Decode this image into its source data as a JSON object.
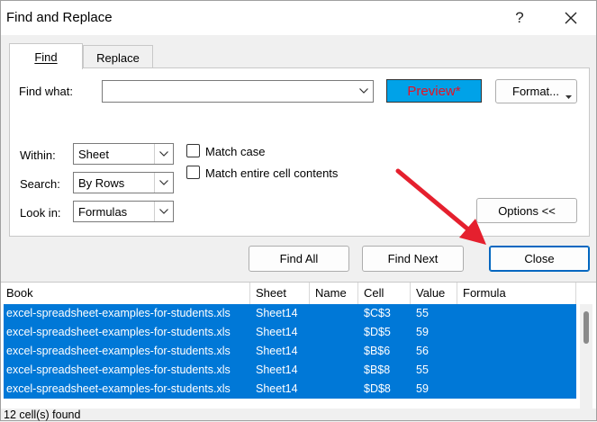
{
  "window": {
    "title": "Find and Replace",
    "help": "?"
  },
  "tabs": {
    "find": "Find",
    "replace": "Replace"
  },
  "find_what": {
    "label": "Find what:",
    "value": ""
  },
  "preview": {
    "label": "Preview*"
  },
  "format_button": "Format...",
  "within": {
    "label": "Within:",
    "value": "Sheet"
  },
  "search": {
    "label": "Search:",
    "value": "By Rows"
  },
  "look_in": {
    "label": "Look in:",
    "value": "Formulas"
  },
  "match_case": {
    "label": "Match case",
    "checked": false
  },
  "match_entire": {
    "label": "Match entire cell contents",
    "checked": false
  },
  "options_button": "Options <<",
  "buttons": {
    "find_all": "Find All",
    "find_next": "Find Next",
    "close": "Close"
  },
  "results": {
    "columns": [
      "Book",
      "Sheet",
      "Name",
      "Cell",
      "Value",
      "Formula"
    ],
    "rows": [
      [
        "excel-spreadsheet-examples-for-students.xls",
        "Sheet14",
        "",
        "$C$3",
        "55",
        ""
      ],
      [
        "excel-spreadsheet-examples-for-students.xls",
        "Sheet14",
        "",
        "$D$5",
        "59",
        ""
      ],
      [
        "excel-spreadsheet-examples-for-students.xls",
        "Sheet14",
        "",
        "$B$6",
        "56",
        ""
      ],
      [
        "excel-spreadsheet-examples-for-students.xls",
        "Sheet14",
        "",
        "$B$8",
        "55",
        ""
      ],
      [
        "excel-spreadsheet-examples-for-students.xls",
        "Sheet14",
        "",
        "$D$8",
        "59",
        ""
      ]
    ]
  },
  "status": "12 cell(s) found",
  "colors": {
    "selection": "#0078d7",
    "preview_bg": "#00a2e8",
    "preview_text": "#e81123",
    "annotation_arrow": "#e5202e"
  }
}
